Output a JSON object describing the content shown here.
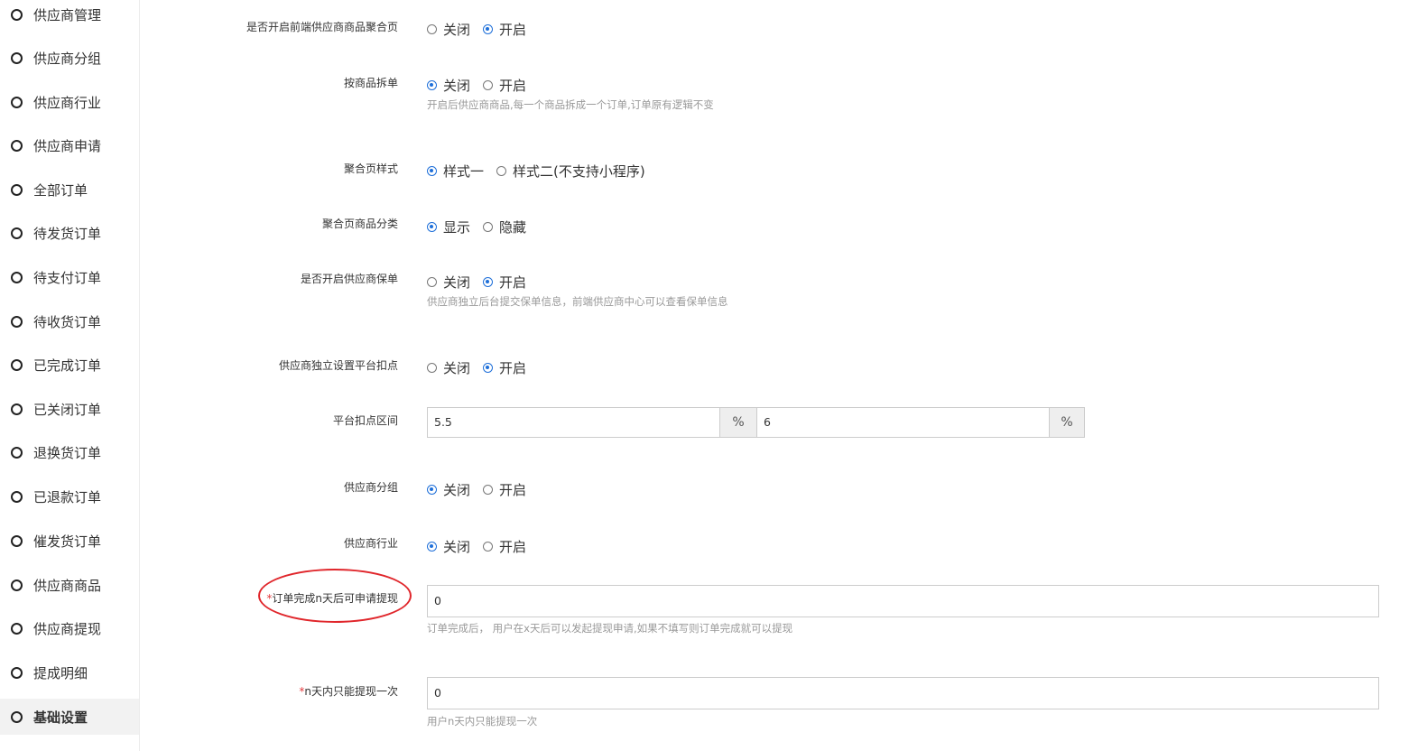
{
  "sidebar": {
    "items": [
      {
        "label": "供应商管理"
      },
      {
        "label": "供应商分组"
      },
      {
        "label": "供应商行业"
      },
      {
        "label": "供应商申请"
      },
      {
        "label": "全部订单"
      },
      {
        "label": "待发货订单"
      },
      {
        "label": "待支付订单"
      },
      {
        "label": "待收货订单"
      },
      {
        "label": "已完成订单"
      },
      {
        "label": "已关闭订单"
      },
      {
        "label": "退换货订单"
      },
      {
        "label": "已退款订单"
      },
      {
        "label": "催发货订单"
      },
      {
        "label": "供应商商品"
      },
      {
        "label": "供应商提现"
      },
      {
        "label": "提成明细"
      },
      {
        "label": "基础设置",
        "active": true
      }
    ]
  },
  "form": {
    "aggregate_page": {
      "label": "是否开启前端供应商商品聚合页",
      "options": [
        "关闭",
        "开启"
      ],
      "selected": "开启"
    },
    "split_order": {
      "label": "按商品拆单",
      "options": [
        "关闭",
        "开启"
      ],
      "selected": "关闭",
      "hint": "开启后供应商商品,每一个商品拆成一个订单,订单原有逻辑不变"
    },
    "aggregate_style": {
      "label": "聚合页样式",
      "options": [
        "样式一",
        "样式二(不支持小程序)"
      ],
      "selected": "样式一"
    },
    "aggregate_category": {
      "label": "聚合页商品分类",
      "options": [
        "显示",
        "隐藏"
      ],
      "selected": "显示"
    },
    "guarantee": {
      "label": "是否开启供应商保单",
      "options": [
        "关闭",
        "开启"
      ],
      "selected": "开启",
      "hint": "供应商独立后台提交保单信息，前端供应商中心可以查看保单信息"
    },
    "independent_deduction": {
      "label": "供应商独立设置平台扣点",
      "options": [
        "关闭",
        "开启"
      ],
      "selected": "开启"
    },
    "deduction_range": {
      "label": "平台扣点区间",
      "min": "5.5",
      "max": "6",
      "unit": "%"
    },
    "supplier_group": {
      "label": "供应商分组",
      "options": [
        "关闭",
        "开启"
      ],
      "selected": "关闭"
    },
    "supplier_industry": {
      "label": "供应商行业",
      "options": [
        "关闭",
        "开启"
      ],
      "selected": "关闭"
    },
    "withdraw_days": {
      "required_mark": "*",
      "label": "订单完成n天后可申请提现",
      "value": "0",
      "hint": "订单完成后， 用户在x天后可以发起提现申请,如果不填写则订单完成就可以提现"
    },
    "withdraw_once": {
      "required_mark": "*",
      "label": "n天内只能提现一次",
      "value": "0",
      "hint": "用户n天内只能提现一次"
    }
  },
  "colors": {
    "accent": "#1e6fd9",
    "annotation": "#e0262b",
    "required": "#e4393c"
  }
}
